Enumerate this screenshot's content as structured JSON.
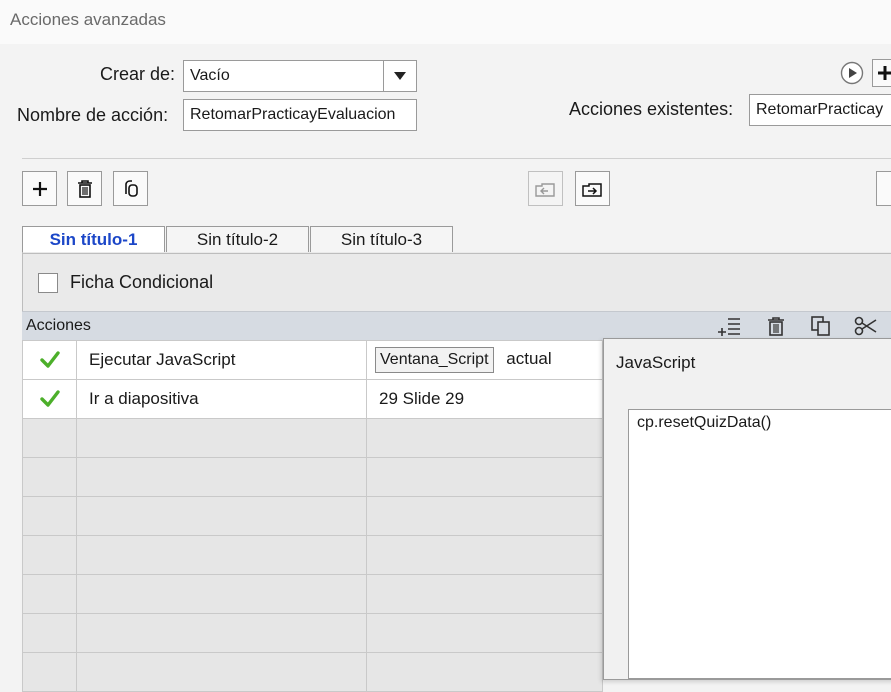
{
  "window": {
    "title": "Acciones avanzadas"
  },
  "form": {
    "create_from_label": "Crear de:",
    "create_from_value": "Vacío",
    "action_name_label": "Nombre de acción:",
    "action_name_value": "RetomarPracticayEvaluacion",
    "existing_label": "Acciones existentes:",
    "existing_value": "RetomarPracticay"
  },
  "toolbar": {
    "left_icons": [
      "plus-icon",
      "trash-icon",
      "duplicate-icon"
    ],
    "mid_icons": [
      "import-icon",
      "export-icon"
    ]
  },
  "tabs": [
    {
      "label": "Sin título-1",
      "active": true
    },
    {
      "label": "Sin título-2",
      "active": false
    },
    {
      "label": "Sin título-3",
      "active": false
    }
  ],
  "conditional": {
    "label": "Ficha Condicional",
    "checked": false
  },
  "actions_header": {
    "label": "Acciones",
    "icons": [
      "insert-row-icon",
      "trash-icon",
      "copy-icon",
      "cut-icon"
    ]
  },
  "rows": [
    {
      "status": "check",
      "action": "Ejecutar JavaScript",
      "button": "Ventana_Script",
      "target": "actual"
    },
    {
      "status": "check",
      "action": "Ir a diapositiva",
      "button": "",
      "target": "29 Slide 29"
    }
  ],
  "js_popup": {
    "title": "JavaScript",
    "code": "cp.resetQuizData()"
  },
  "colors": {
    "active_tab_text": "#1c47c8",
    "check_green": "#4caf2a",
    "header_bg": "#d6dbe2"
  }
}
